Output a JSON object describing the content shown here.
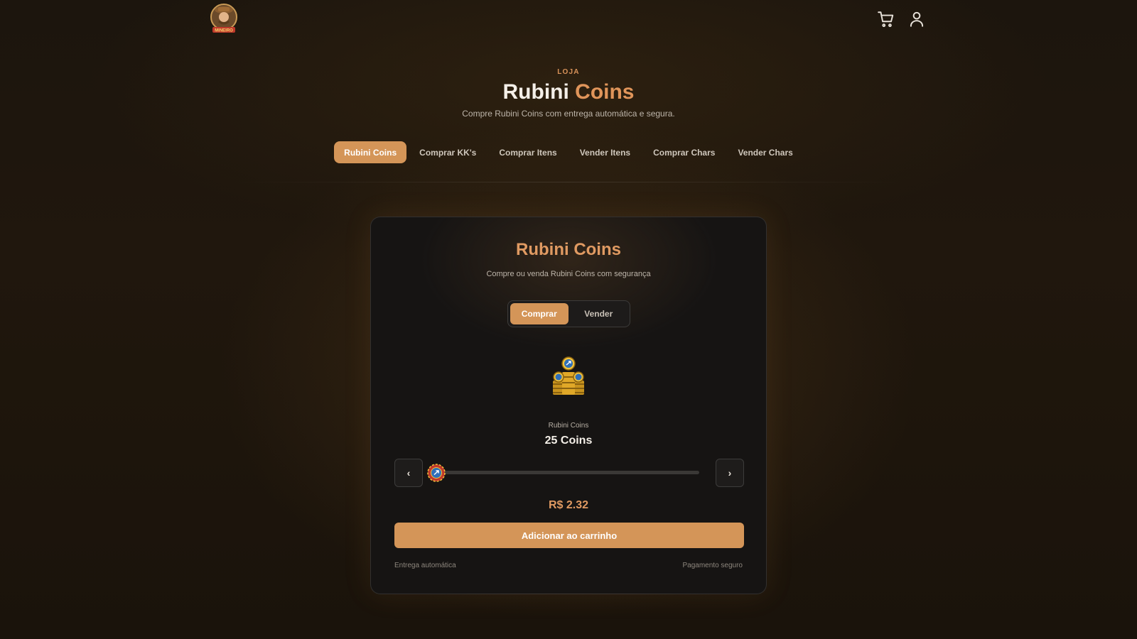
{
  "header": {
    "logo_alt": "MINEIRO COINS",
    "icons": [
      "cart-icon",
      "user-icon"
    ]
  },
  "hero": {
    "eyebrow": "LOJA",
    "title_main": "Rubini",
    "title_accent": "Coins",
    "subtitle": "Compre Rubini Coins com entrega automática e segura."
  },
  "tabs": [
    {
      "label": "Rubini Coins",
      "active": true
    },
    {
      "label": "Comprar KK's",
      "active": false
    },
    {
      "label": "Comprar Itens",
      "active": false
    },
    {
      "label": "Vender Itens",
      "active": false
    },
    {
      "label": "Comprar Chars",
      "active": false
    },
    {
      "label": "Vender Chars",
      "active": false
    }
  ],
  "card": {
    "title": "Rubini Coins",
    "subtitle": "Compre ou venda Rubini Coins com segurança",
    "toggle": {
      "buy_label": "Comprar",
      "sell_label": "Vender",
      "active": "Comprar"
    },
    "product_label": "Rubini Coins",
    "amount": "25 Coins",
    "prev_label": "‹",
    "next_label": "›",
    "slider_fraction": 0.0,
    "price": "R$ 2.32",
    "add_button": "Adicionar ao carrinho",
    "footer_left": "Entrega automática",
    "footer_right": "Pagamento seguro"
  },
  "colors": {
    "accent": "#d49558",
    "accent_text": "#e09a62",
    "background": "#1c150d",
    "card": "#161413"
  }
}
